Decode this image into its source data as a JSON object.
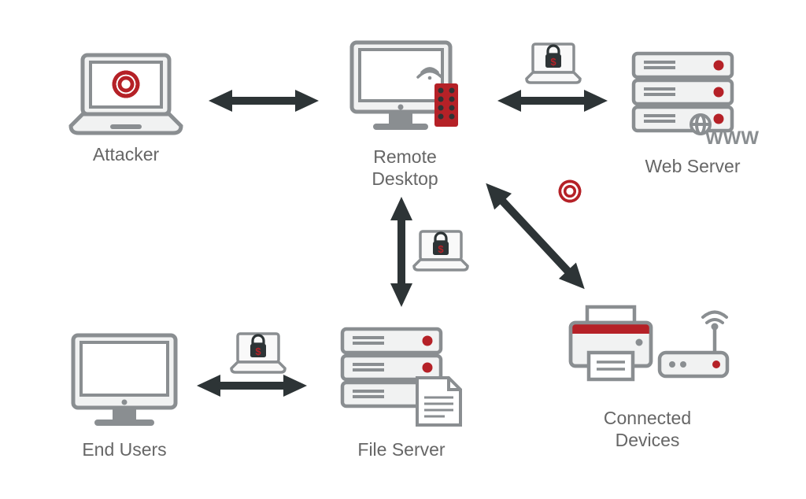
{
  "nodes": {
    "attacker": {
      "label": "Attacker"
    },
    "remote_desktop": {
      "label": "Remote\nDesktop"
    },
    "web_server": {
      "label": "Web Server",
      "www": "WWW"
    },
    "end_users": {
      "label": "End Users"
    },
    "file_server": {
      "label": "File Server"
    },
    "connected_devices": {
      "label": "Connected\nDevices"
    }
  },
  "overlays": {
    "ransom_rd_ws": {
      "tag": "$"
    },
    "ransom_rd_fs": {
      "tag": "$"
    },
    "ransom_eu_fs": {
      "tag": "$"
    }
  },
  "colors": {
    "stroke": "#8a8e91",
    "arrow": "#2d3436",
    "red": "#b52127"
  }
}
